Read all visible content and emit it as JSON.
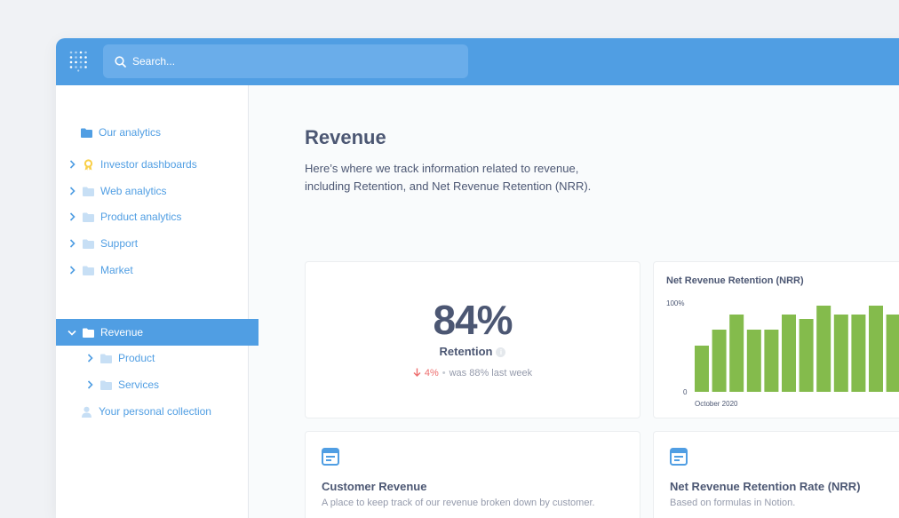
{
  "colors": {
    "brand": "#509ee3",
    "bar": "#84bb4c",
    "text": "#4c5773",
    "muted": "#949aab",
    "negative": "#ed6e6e"
  },
  "search": {
    "placeholder": "Search...",
    "icon": "search-icon"
  },
  "sidebar": {
    "items": [
      {
        "label": "Our analytics",
        "icon": "folder-icon",
        "expandable": false,
        "active": false,
        "level": 0
      },
      {
        "label": "Investor dashboards",
        "icon": "badge-icon",
        "expandable": true,
        "active": false,
        "level": 0
      },
      {
        "label": "Web analytics",
        "icon": "folder-icon",
        "expandable": true,
        "active": false,
        "level": 0
      },
      {
        "label": "Product analytics",
        "icon": "folder-icon",
        "expandable": true,
        "active": false,
        "level": 0
      },
      {
        "label": "Support",
        "icon": "folder-icon",
        "expandable": true,
        "active": false,
        "level": 0
      },
      {
        "label": "Market",
        "icon": "folder-icon",
        "expandable": true,
        "active": false,
        "level": 0
      },
      {
        "label": "Revenue",
        "icon": "folder-icon",
        "expandable": true,
        "active": true,
        "level": 0
      },
      {
        "label": "Product",
        "icon": "folder-icon",
        "expandable": true,
        "active": false,
        "level": 1
      },
      {
        "label": "Services",
        "icon": "folder-icon",
        "expandable": true,
        "active": false,
        "level": 1
      },
      {
        "label": "Your personal collection",
        "icon": "person-icon",
        "expandable": false,
        "active": false,
        "level": 0
      }
    ]
  },
  "page": {
    "title": "Revenue",
    "description": "Here’s where we track information related to revenue, including Retention, and Net Revenue Retention (NRR)."
  },
  "metric": {
    "value": "84%",
    "label": "Retention",
    "change": "4%",
    "comparison": "was 88% last week"
  },
  "chart_data": {
    "type": "bar",
    "title": "Net Revenue Retention (NRR)",
    "y_tick_labels": [
      "100%",
      "0"
    ],
    "x_tick_label": "October 2020",
    "ylim": [
      0,
      100
    ],
    "values": [
      52,
      70,
      87,
      70,
      70,
      87,
      82,
      97,
      87,
      87,
      97,
      87
    ],
    "grid": false,
    "legend": false
  },
  "cards": [
    {
      "title": "Customer Revenue",
      "description": "A place to keep track of our revenue broken down by customer.",
      "icon": "document-icon"
    },
    {
      "title": "Net Revenue Retention Rate (NRR)",
      "description": "Based on formulas in Notion.",
      "icon": "document-icon"
    }
  ]
}
